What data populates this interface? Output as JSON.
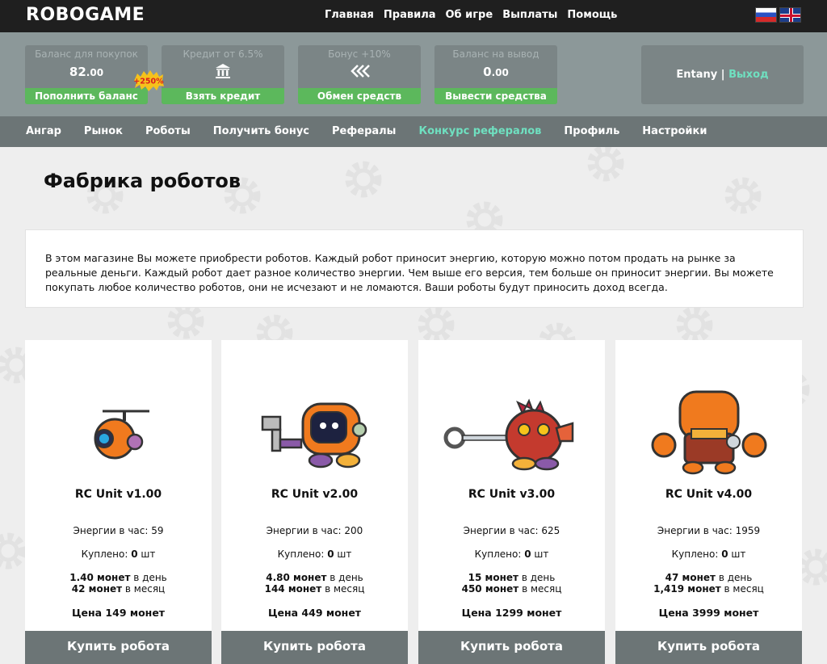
{
  "header": {
    "logo": "ROBOGAME",
    "nav": [
      "Главная",
      "Правила",
      "Об игре",
      "Выплаты",
      "Помощь"
    ],
    "flags": [
      "flag-ru",
      "flag-en"
    ]
  },
  "balances": [
    {
      "label": "Баланс для покупок",
      "value_int": "82",
      "value_dec": ".00",
      "button": "Пополнить баланс"
    },
    {
      "label": "Кредит от 6.5%",
      "icon": "bank-icon",
      "button": "Взять кредит"
    },
    {
      "label": "Бонус +10%",
      "icon": "double-chevron-left-icon",
      "button": "Обмен средств"
    },
    {
      "label": "Баланс на вывод",
      "value_int": "0",
      "value_dec": ".00",
      "button": "Вывести средства"
    }
  ],
  "bonus_badge": "+250%",
  "user": {
    "name": "Entany",
    "separator": " | ",
    "logout": "Выход"
  },
  "mainnav": [
    "Ангар",
    "Рынок",
    "Роботы",
    "Получить бонус",
    "Рефералы",
    "Конкурс рефералов",
    "Профиль",
    "Настройки"
  ],
  "page": {
    "title": "Фабрика роботов",
    "intro": "В этом магазине Вы можете приобрести роботов. Каждый робот приносит энергию, которую можно потом продать на рынке за реальные деньги. Каждый робот дает разное количество энергии. Чем выше его версия, тем больше он приносит энергии. Вы можете покупать любое количество роботов, они не исчезают и не ломаются. Ваши роботы будут приносить доход всегда."
  },
  "robots": [
    {
      "name": "RC Unit v1.00",
      "energy_label": "Энергии в час: ",
      "energy": "59",
      "bought_label": "Куплено: ",
      "bought": "0",
      "bought_unit": " шт",
      "per_day": "1.40 монет",
      "per_day_label": " в день",
      "per_month": "42 монет",
      "per_month_label": " в месяц",
      "price": "Цена 149 монет",
      "button": "Купить робота"
    },
    {
      "name": "RC Unit v2.00",
      "energy_label": "Энергии в час: ",
      "energy": "200",
      "bought_label": "Куплено: ",
      "bought": "0",
      "bought_unit": " шт",
      "per_day": "4.80 монет",
      "per_day_label": " в день",
      "per_month": "144 монет",
      "per_month_label": " в месяц",
      "price": "Цена 449 монет",
      "button": "Купить робота"
    },
    {
      "name": "RC Unit v3.00",
      "energy_label": "Энергии в час: ",
      "energy": "625",
      "bought_label": "Куплено: ",
      "bought": "0",
      "bought_unit": " шт",
      "per_day": "15 монет",
      "per_day_label": " в день",
      "per_month": "450 монет",
      "per_month_label": " в месяц",
      "price": "Цена 1299 монет",
      "button": "Купить робота"
    },
    {
      "name": "RC Unit v4.00",
      "energy_label": "Энергии в час: ",
      "energy": "1959",
      "bought_label": "Куплено: ",
      "bought": "0",
      "bought_unit": " шт",
      "per_day": "47 монет",
      "per_day_label": " в день",
      "per_month": "1,419 монет",
      "per_month_label": " в месяц",
      "price": "Цена 3999 монет",
      "button": "Купить робота"
    }
  ],
  "colors": {
    "accent": "#6fe0c0",
    "green": "#5cb85c",
    "topbar": "#1f1f1f",
    "balbar": "#8c9899",
    "nav": "#6c7576",
    "robot_orange": "#f07a1e"
  }
}
